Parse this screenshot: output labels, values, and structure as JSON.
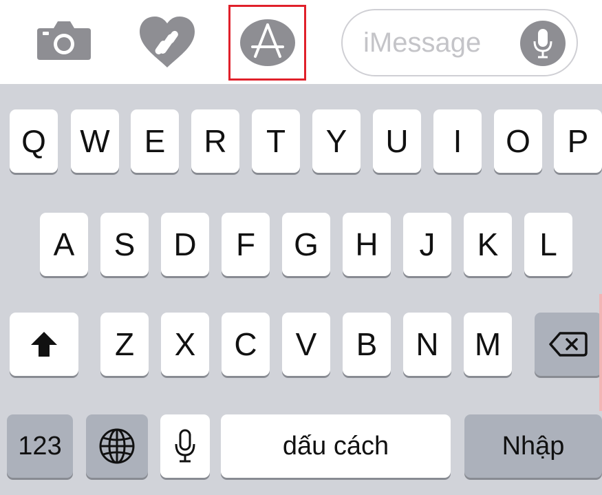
{
  "toolbar": {
    "icons": [
      "camera-icon",
      "digital-touch-icon",
      "app-store-icon"
    ],
    "message_field": {
      "placeholder": "iMessage",
      "mic_icon": "microphone-icon"
    },
    "highlight_color": "#e0202a"
  },
  "keyboard": {
    "row1": [
      "Q",
      "W",
      "E",
      "R",
      "T",
      "Y",
      "U",
      "I",
      "O",
      "P"
    ],
    "row2": [
      "A",
      "S",
      "D",
      "F",
      "G",
      "H",
      "J",
      "K",
      "L"
    ],
    "row3": [
      "Z",
      "X",
      "C",
      "V",
      "B",
      "N",
      "M"
    ],
    "row3_special": {
      "shift_icon": "shift-icon",
      "delete_icon": "delete-icon"
    },
    "bottom": {
      "numbers": "123",
      "globe_icon": "globe-icon",
      "dictation_icon": "microphone-icon",
      "space": "dấu cách",
      "return": "Nhập"
    },
    "colors": {
      "background": "#d1d3d9",
      "key": "#ffffff",
      "function_key": "#acb1bb"
    }
  }
}
